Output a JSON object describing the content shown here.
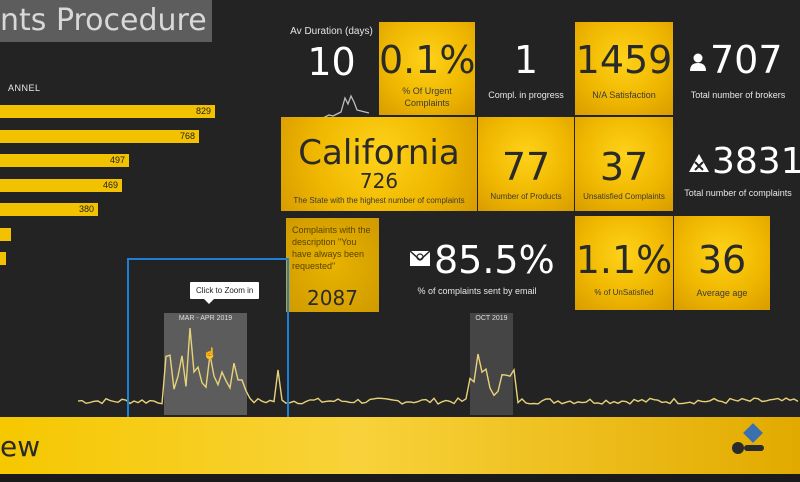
{
  "header": {
    "title": "nts Procedure"
  },
  "channel_chart": {
    "label": "ANNEL",
    "bars": [
      {
        "value": "829",
        "fill": 1.0
      },
      {
        "value": "768",
        "fill": 0.926
      },
      {
        "value": "497",
        "fill": 0.6
      },
      {
        "value": "469",
        "fill": 0.566
      },
      {
        "value": "380",
        "fill": 0.458
      },
      {
        "value": "",
        "fill": 0.05
      },
      {
        "value": "",
        "fill": 0.03
      }
    ]
  },
  "kpis": {
    "av_duration": {
      "label": "Av Duration (days)",
      "value": "10"
    },
    "urgent": {
      "value": "0.1%",
      "label": "% Of Urgent Complaints"
    },
    "in_progress": {
      "value": "1",
      "label": "Compl. in progress"
    },
    "na_satisfaction": {
      "value": "1459",
      "label": "N/A Satisfaction"
    },
    "brokers": {
      "value": "707",
      "label": "Total number of brokers"
    },
    "state": {
      "value": "California",
      "count": "726",
      "label": "The State with the highest number of complaints"
    },
    "products": {
      "value": "77",
      "label": "Number of Products"
    },
    "unsatisfied": {
      "value": "37",
      "label": "Unsatisfied Complaints"
    },
    "total_complaints": {
      "value": "3831",
      "label": "Total number of complaints"
    },
    "description": {
      "label": "Complaints with the description \"You have always been requested\"",
      "value": "2087"
    },
    "sent_by_email": {
      "value": "85.5%",
      "label": "% of complaints sent by email"
    },
    "pct_unsatisfied": {
      "value": "1.1%",
      "label": "% of UnSatisfied"
    },
    "average_age": {
      "value": "36",
      "label": "Average age"
    }
  },
  "timeline": {
    "period1": "MAR - APR 2019",
    "period2": "OCT 2019",
    "tooltip": "Click to Zoom in"
  },
  "footer": {
    "text": "ew"
  },
  "colors": {
    "accent": "#f2c200",
    "selection": "#1f7fd6",
    "background": "#232323"
  },
  "icons": {
    "brokers": "person-icon",
    "total": "x-badge-icon",
    "email": "envelope-icon"
  }
}
